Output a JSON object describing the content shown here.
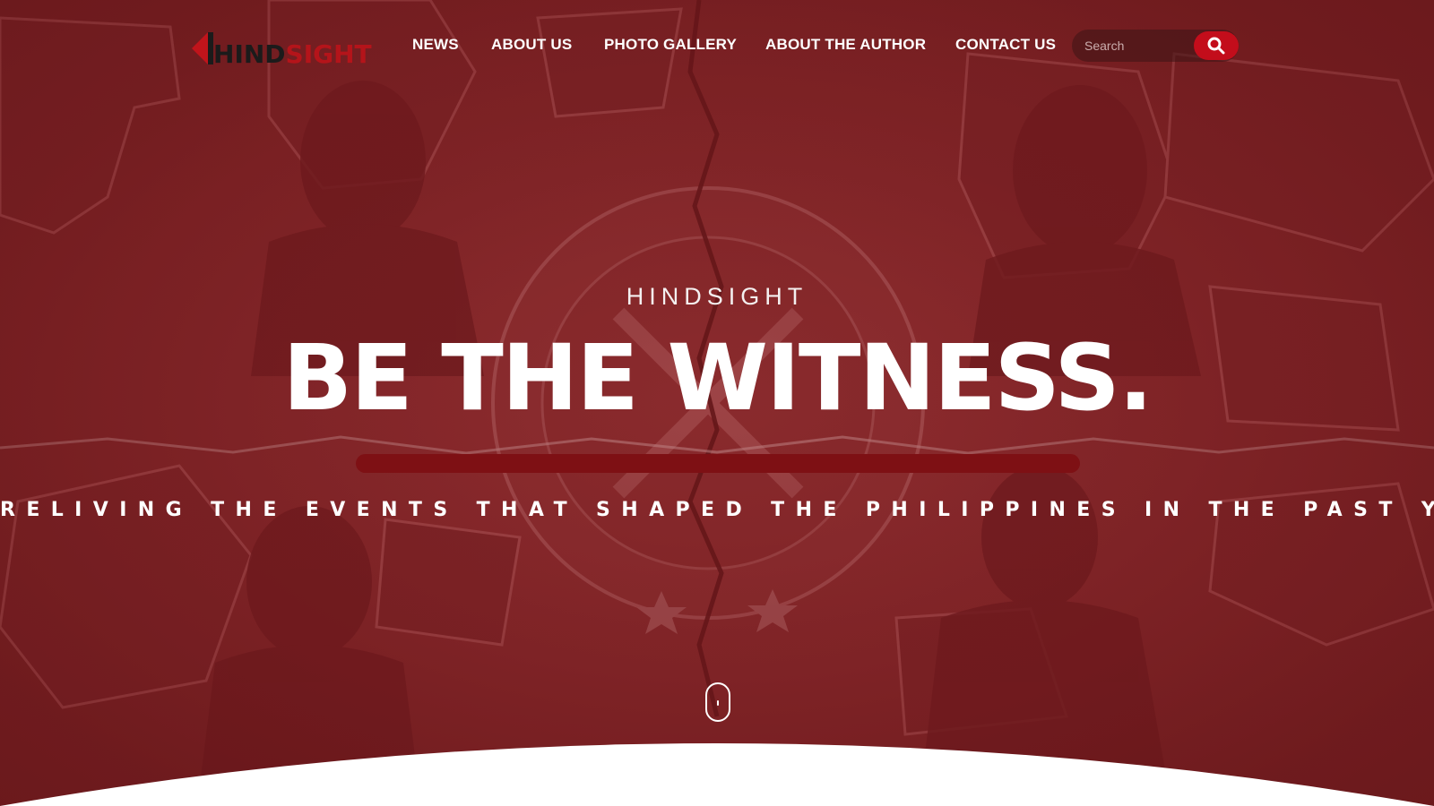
{
  "header": {
    "logo": {
      "text_a": "H",
      "text_b": "IND",
      "text_c": "SIGHT"
    },
    "nav": [
      {
        "label": "NEWS"
      },
      {
        "label": "ABOUT US"
      },
      {
        "label": "PHOTO GALLERY"
      },
      {
        "label": "ABOUT THE AUTHOR"
      },
      {
        "label": "CONTACT US"
      }
    ],
    "search": {
      "placeholder": "Search"
    }
  },
  "hero": {
    "kicker": "HINDSIGHT",
    "headline": "BE THE WITNESS.",
    "tagline": "RELIVING THE EVENTS THAT SHAPED THE PHILIPPINES IN THE PAST YEARS"
  },
  "theme": {
    "background_tint": "#8a2a2c",
    "accent_red": "#c30d1b",
    "bar_red": "#7e1014",
    "text_white": "#ffffff"
  },
  "icons": {
    "search": "search-icon",
    "scroll": "scroll-mouse-icon"
  }
}
